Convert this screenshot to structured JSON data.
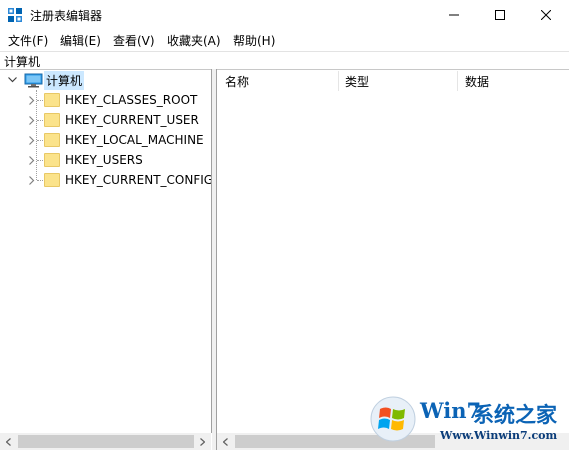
{
  "window": {
    "title": "注册表编辑器"
  },
  "menu": [
    "文件(F)",
    "编辑(E)",
    "查看(V)",
    "收藏夹(A)",
    "帮助(H)"
  ],
  "address": "计算机",
  "tree": {
    "root": "计算机",
    "keys": [
      "HKEY_CLASSES_ROOT",
      "HKEY_CURRENT_USER",
      "HKEY_LOCAL_MACHINE",
      "HKEY_USERS",
      "HKEY_CURRENT_CONFIG"
    ]
  },
  "columns": [
    "名称",
    "类型",
    "数据"
  ],
  "watermark": {
    "brand_a": "Win7",
    "brand_b": "系统之家",
    "url": "Www.Winwin7.com"
  },
  "colors": {
    "selection": "#cce8ff",
    "folder": "#fbe38b",
    "accent": "#0078d7"
  }
}
